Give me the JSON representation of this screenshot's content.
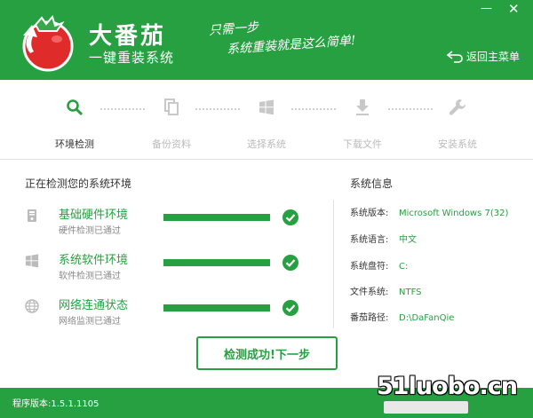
{
  "header": {
    "brand_title": "大番茄",
    "brand_subtitle": "一键重装系统",
    "slogan_line1": "只需一步",
    "slogan_line2": "系统重装就是这么简单!",
    "minimize": "—",
    "close": "✕",
    "back_label": "返回主菜单"
  },
  "steps": [
    {
      "label": "环境检测",
      "icon": "search-icon",
      "active": true
    },
    {
      "label": "备份资料",
      "icon": "copy-icon",
      "active": false
    },
    {
      "label": "选择系统",
      "icon": "windows-icon",
      "active": false
    },
    {
      "label": "下载文件",
      "icon": "download-icon",
      "active": false
    },
    {
      "label": "安装系统",
      "icon": "wrench-icon",
      "active": false
    }
  ],
  "checks": {
    "title": "正在检测您的系统环境",
    "items": [
      {
        "title": "基础硬件环境",
        "sub": "硬件检测已通过",
        "icon": "hardware-icon",
        "progress": 1.0
      },
      {
        "title": "系统软件环境",
        "sub": "软件检测已通过",
        "icon": "windows-icon",
        "progress": 1.0
      },
      {
        "title": "网络连通状态",
        "sub": "网络监测已通过",
        "icon": "globe-icon",
        "progress": 1.0
      }
    ]
  },
  "sysinfo": {
    "title": "系统信息",
    "rows": [
      {
        "key": "系统版本:",
        "value": "Microsoft Windows 7(32)"
      },
      {
        "key": "系统语言:",
        "value": "中文"
      },
      {
        "key": "系统盘符:",
        "value": "C:"
      },
      {
        "key": "文件系统:",
        "value": "NTFS"
      },
      {
        "key": "番茄路径:",
        "value": "D:\\DaFanQie"
      }
    ]
  },
  "next_button": "检测成功!下一步",
  "footer": {
    "version": "程序版本:1.5.1.1105"
  },
  "watermark": "51luobo.cn",
  "colors": {
    "accent": "#27a042"
  }
}
